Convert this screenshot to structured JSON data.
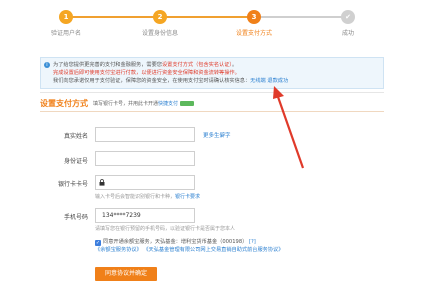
{
  "steps": [
    {
      "number": "1",
      "label": "验证用户名"
    },
    {
      "number": "2",
      "label": "设置身份信息"
    },
    {
      "number": "3",
      "label": "设置支付方式"
    },
    {
      "number": "",
      "label": "成功"
    }
  ],
  "notice": {
    "line1_a": "为了给您提供更完善的支付和金融服务，需要您",
    "line1_link": "设置支付方式（包含实名认证）",
    "line1_b": "。",
    "line2": "完成设置后即可使用支付宝进行付款，以便进行资金安全保障和资金流转等操作。",
    "line3_a": "我们向您承诺仅用于支付验证，保障您的资金安全，在使用支付宝时请确认核实信息：",
    "line3_link1": "无线端",
    "line3_link2": "退款成功"
  },
  "section": {
    "title": "设置支付方式",
    "subtitle": "填写银行卡号，并用此卡开通",
    "subtitle_link": "快捷支付"
  },
  "form": {
    "name_label": "真实姓名",
    "name_side_link": "更多生僻字",
    "id_label": "身份证号",
    "card_label": "银行卡卡号",
    "card_hint": "输入卡号后会智能识别银行和卡种，",
    "card_hint_link": "银行卡要求",
    "phone_label": "手机号码",
    "phone_value": "134****7239",
    "phone_hint": "请填写您在银行预留的手机号码，以验证银行卡是否属于您本人"
  },
  "agree": {
    "line1_a": "同意开通余额宝服务，天弘基金：增利宝货币基金（000198）",
    "line1_link": "[?]",
    "line2_link1": "《余额宝服务协议》",
    "line2_link2": "《天弘基金管理有限公司网上交易直销自助式前台服务协议》"
  },
  "submit_label": "同意协议并确定",
  "colors": {
    "accent": "#f08019",
    "link": "#2a7fd0",
    "arrow": "#e03a2a"
  }
}
